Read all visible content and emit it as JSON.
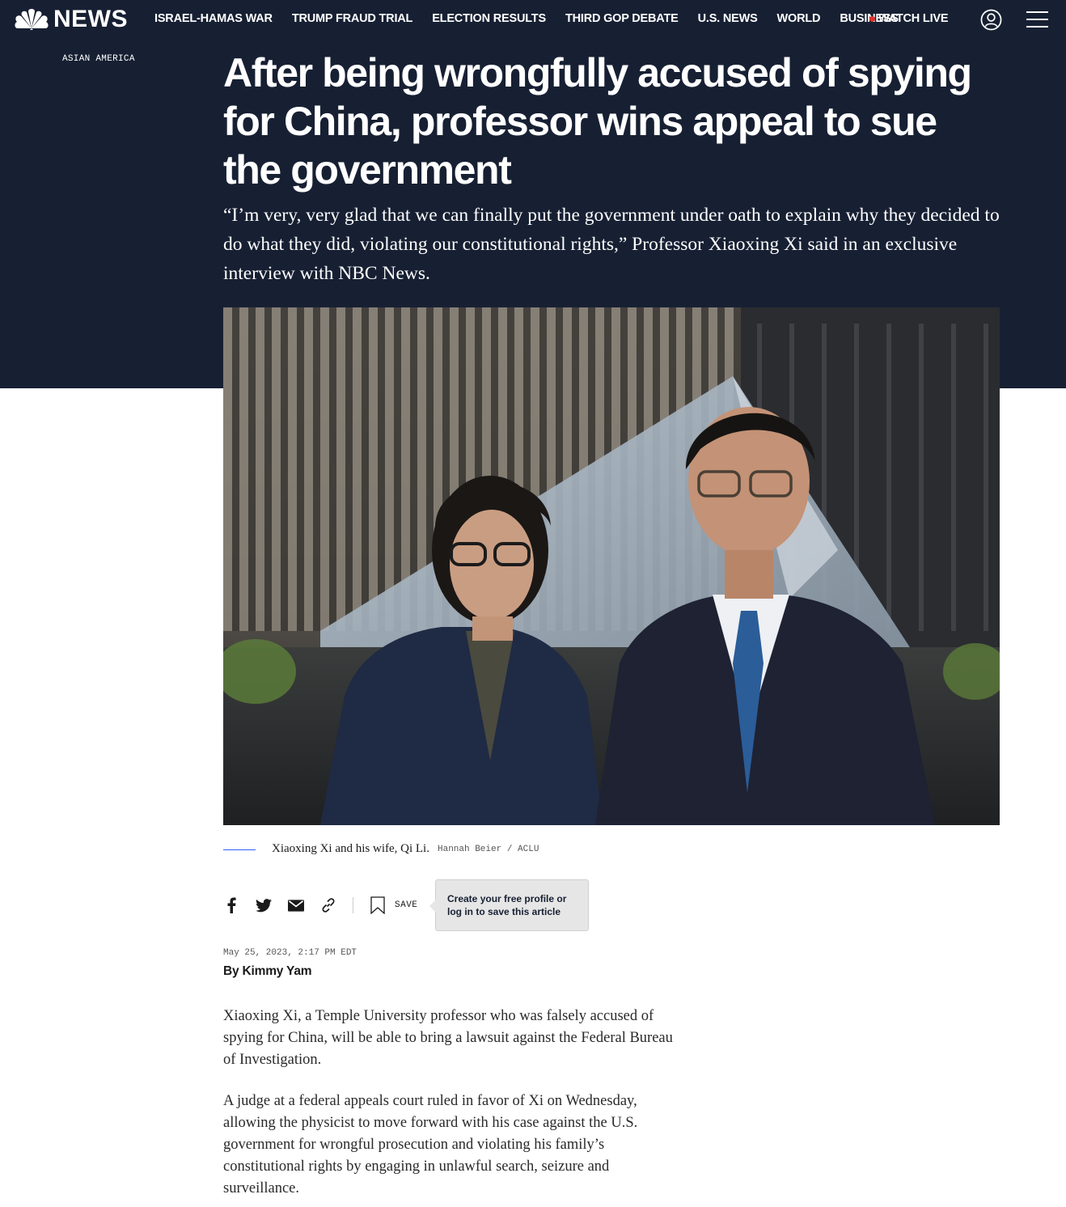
{
  "brand": {
    "name": "NEWS"
  },
  "nav": {
    "items": [
      "ISRAEL-HAMAS WAR",
      "TRUMP FRAUD TRIAL",
      "ELECTION RESULTS",
      "THIRD GOP DEBATE",
      "U.S. NEWS",
      "WORLD",
      "BUSINESS"
    ],
    "watch_live": "WATCH LIVE"
  },
  "article": {
    "section": "ASIAN AMERICA",
    "headline": "After being wrongfully accused of spying for China, professor wins appeal to sue the government",
    "dek": "“I’m very, very glad that we can finally put the government under oath to explain why they decided to do what they did, violating our constitutional rights,” Professor Xiaoxing Xi said in an exclusive interview with NBC News.",
    "caption": "Xiaoxing Xi and his wife, Qi Li.",
    "credit": "Hannah Beier / ACLU",
    "save_label": "SAVE",
    "save_tooltip": "Create your free profile or log in to save this article",
    "timestamp": "May 25, 2023, 2:17 PM EDT",
    "byline_prefix": "By",
    "author": "Kimmy Yam",
    "paragraphs": [
      "Xiaoxing Xi, a Temple University professor who was falsely accused of spying for China, will be able to bring a lawsuit against the Federal Bureau of Investigation.",
      "A judge at a federal appeals court ruled in favor of Xi on Wednesday, allowing the physicist to move forward with his case against the U.S. government for wrongful prosecution and violating his family’s constitutional rights by engaging in unlawful search, seizure and surveillance."
    ]
  },
  "icons": {
    "logo": "nbc-peacock-icon",
    "profile": "user-profile-icon",
    "menu": "hamburger-menu-icon",
    "share": [
      "facebook-icon",
      "twitter-icon",
      "email-icon",
      "link-icon"
    ],
    "save": "bookmark-icon"
  },
  "colors": {
    "header_bg": "#172033",
    "live_dot": "#e0312a",
    "caption_rule": "#3061ff"
  }
}
